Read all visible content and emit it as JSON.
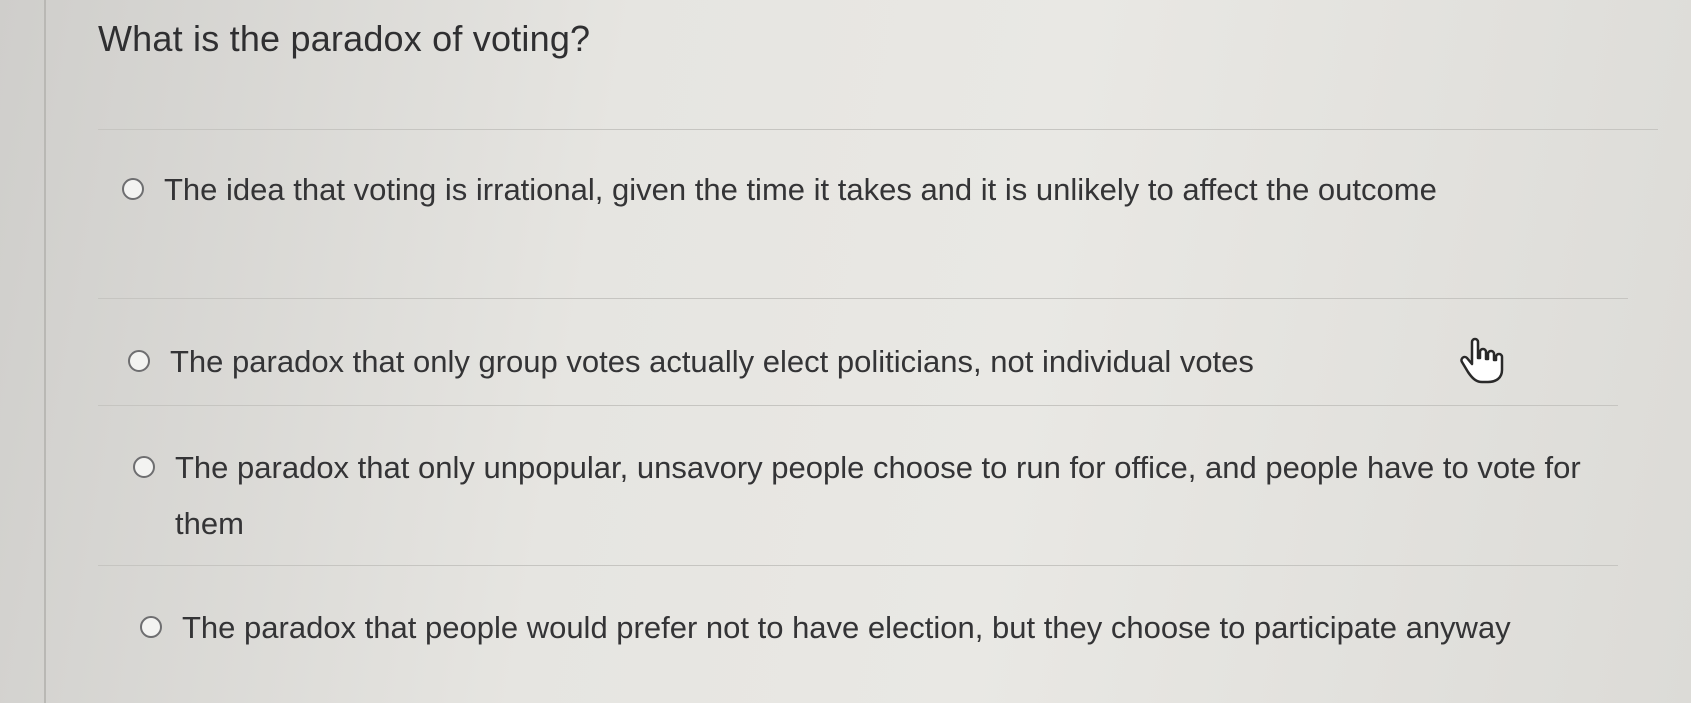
{
  "question": {
    "title": "What is the paradox of voting?"
  },
  "options": [
    {
      "label": "The idea that voting is irrational, given the time it takes and it is unlikely to affect the outcome",
      "selected": false
    },
    {
      "label": "The paradox that only group votes actually elect politicians, not individual votes",
      "selected": false
    },
    {
      "label": "The paradox that only unpopular, unsavory people choose to run for office, and people have to vote for them",
      "selected": false
    },
    {
      "label": "The paradox that people would prefer not to have election, but they choose to participate anyway",
      "selected": false
    }
  ],
  "cursor": {
    "icon": "hand-pointer-icon"
  }
}
